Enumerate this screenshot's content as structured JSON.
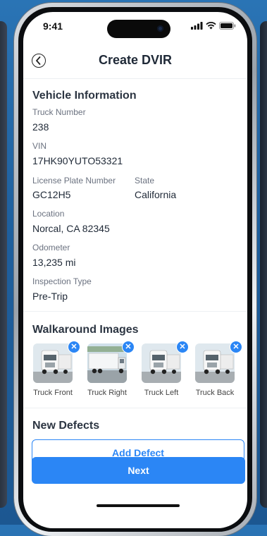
{
  "status_bar": {
    "time": "9:41"
  },
  "header": {
    "title": "Create DVIR"
  },
  "vehicle": {
    "section_title": "Vehicle Information",
    "truck_number_label": "Truck Number",
    "truck_number": "238",
    "vin_label": "VIN",
    "vin": "17HK90YUTO53321",
    "plate_label": "License Plate Number",
    "plate": "GC12H5",
    "state_label": "State",
    "state": "California",
    "location_label": "Location",
    "location": "Norcal, CA 82345",
    "odometer_label": "Odometer",
    "odometer": "13,235 mi",
    "inspection_label": "Inspection Type",
    "inspection": "Pre-Trip"
  },
  "walkaround": {
    "section_title": "Walkaround Images",
    "images": [
      {
        "label": "Truck Front",
        "remove_icon": "close-icon"
      },
      {
        "label": "Truck Right",
        "remove_icon": "close-icon"
      },
      {
        "label": "Truck Left",
        "remove_icon": "close-icon"
      },
      {
        "label": "Truck Back",
        "remove_icon": "close-icon"
      }
    ]
  },
  "defects": {
    "section_title": "New Defects",
    "add_label": "Add Defect"
  },
  "footer": {
    "next_label": "Next"
  },
  "colors": {
    "accent": "#2b86f5",
    "background": "#1e5f9d"
  }
}
